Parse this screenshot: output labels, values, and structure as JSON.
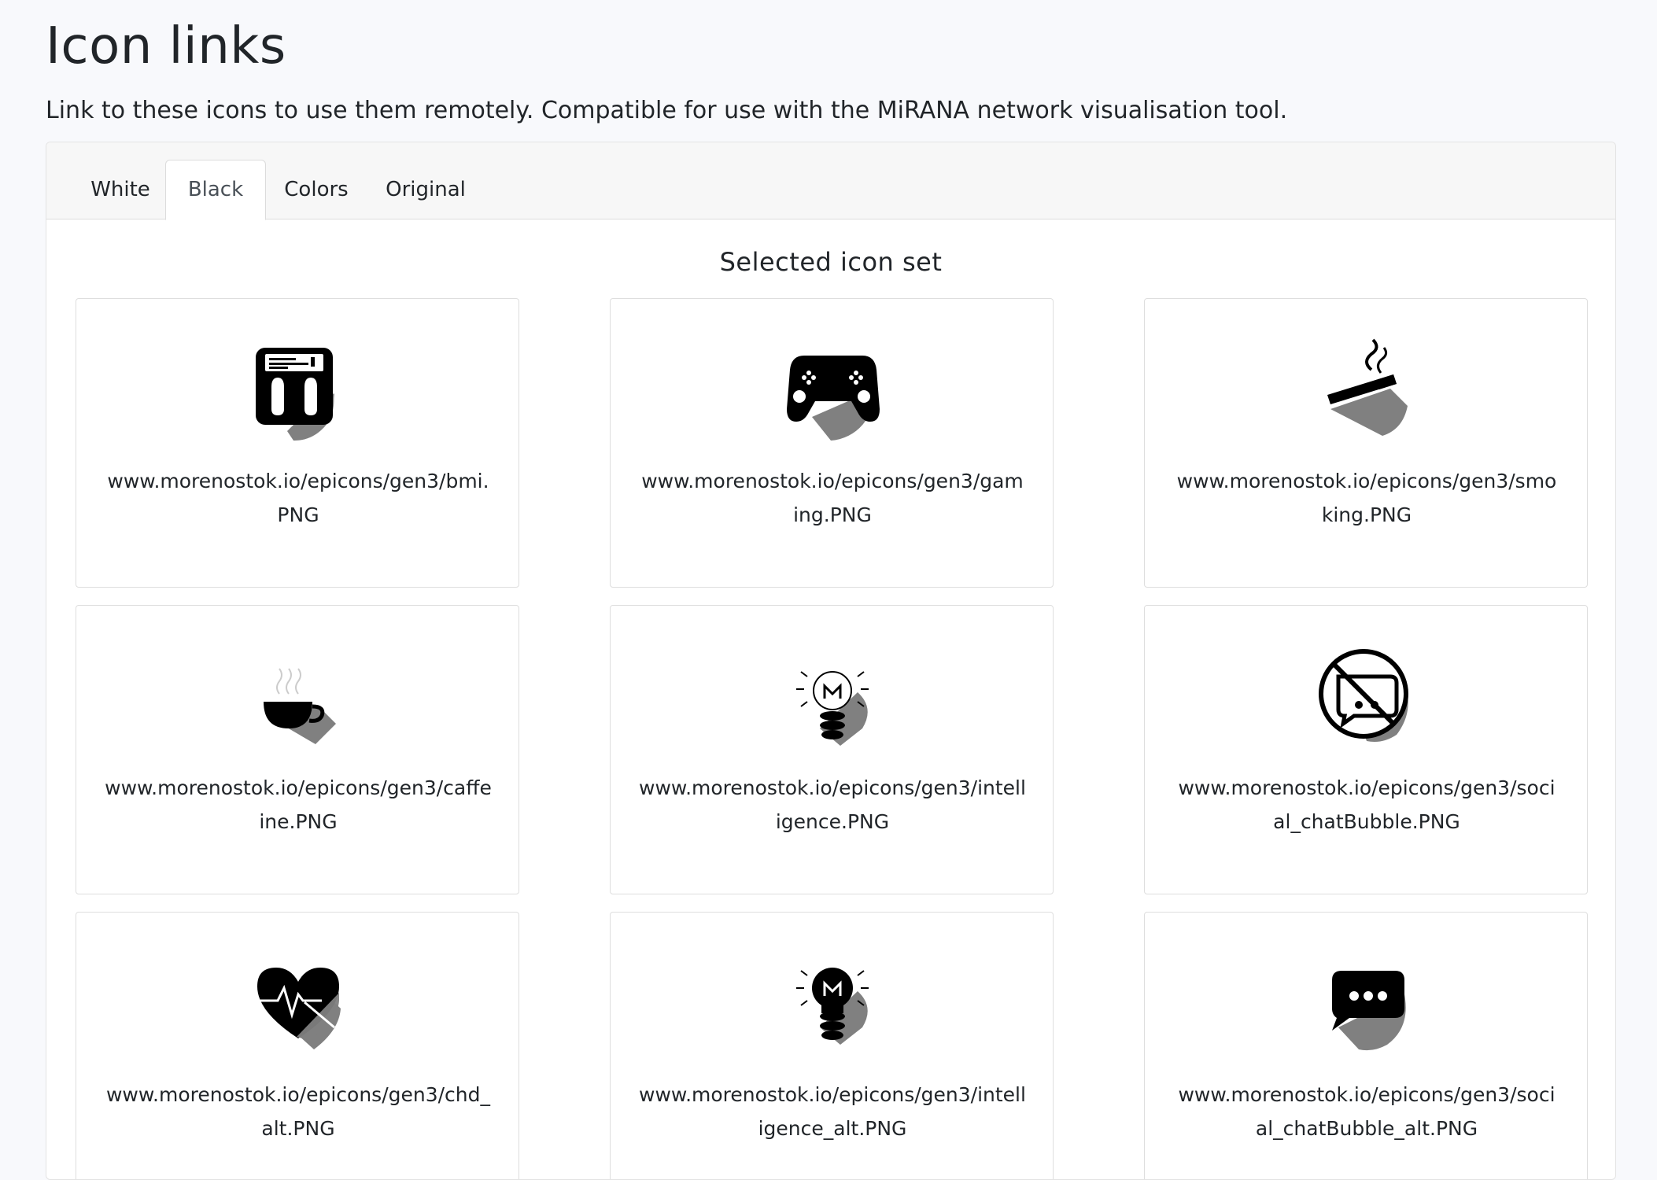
{
  "page": {
    "title": "Icon links",
    "subtitle": "Link to these icons to use them remotely. Compatible for use with the MiRANA network visualisation tool."
  },
  "tabs": [
    {
      "label": "White",
      "active": false
    },
    {
      "label": "Black",
      "active": true
    },
    {
      "label": "Colors",
      "active": false
    },
    {
      "label": "Original",
      "active": false
    }
  ],
  "section": {
    "title": "Selected icon set"
  },
  "icons": [
    {
      "icon": "bmi-scale-icon",
      "url": "www.morenostok.io/epicons/gen3/bmi.PNG"
    },
    {
      "icon": "gaming-controller-icon",
      "url": "www.morenostok.io/epicons/gen3/gaming.PNG"
    },
    {
      "icon": "smoking-cigarette-icon",
      "url": "www.morenostok.io/epicons/gen3/smoking.PNG"
    },
    {
      "icon": "caffeine-cup-icon",
      "url": "www.morenostok.io/epicons/gen3/caffeine.PNG"
    },
    {
      "icon": "intelligence-bulb-icon",
      "url": "www.morenostok.io/epicons/gen3/intelligence.PNG"
    },
    {
      "icon": "no-chat-bubble-icon",
      "url": "www.morenostok.io/epicons/gen3/social_chatBubble.PNG"
    },
    {
      "icon": "heart-pulse-icon",
      "url": "www.morenostok.io/epicons/gen3/chd_alt.PNG"
    },
    {
      "icon": "dark-bulb-icon",
      "url": "www.morenostok.io/epicons/gen3/intelligence_alt.PNG"
    },
    {
      "icon": "chat-bubble-dots-icon",
      "url": "www.morenostok.io/epicons/gen3/social_chatBubble_alt.PNG"
    }
  ],
  "colors": {
    "icon_fill": "#000000",
    "icon_shadow": "#808080",
    "page_background": "#f8f9fc"
  }
}
